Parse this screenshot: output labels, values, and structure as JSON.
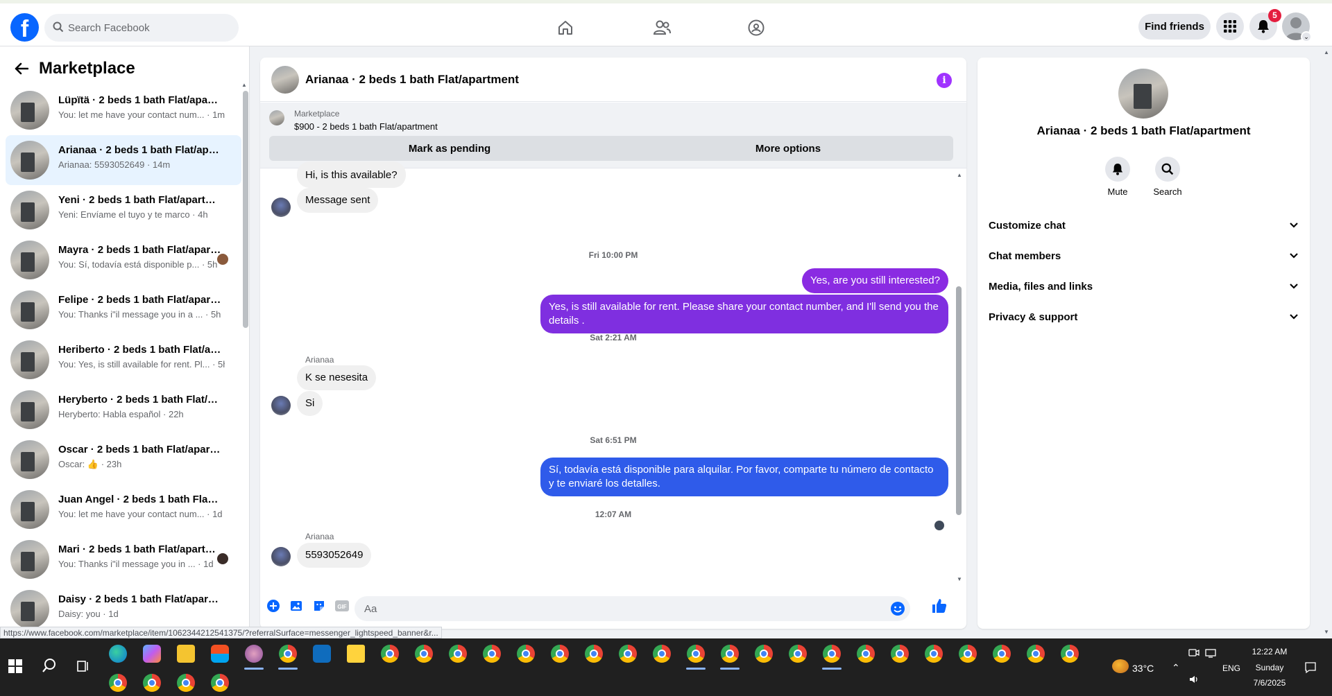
{
  "topbar": {
    "search_placeholder": "Search Facebook",
    "find_friends": "Find friends",
    "notif_count": "5",
    "nav_icons": [
      "home-icon",
      "friends-icon",
      "groups-icon"
    ]
  },
  "sidebar": {
    "title": "Marketplace",
    "conversations": [
      {
        "name": "Lüpïtä · 2 beds 1 bath Flat/apartment",
        "snippet": "You: let me have your contact num... · 1m"
      },
      {
        "name": "Arianaa · 2 beds 1 bath Flat/apartment",
        "snippet": "Arianaa: 5593052649 · 14m"
      },
      {
        "name": "Yeni · 2 beds 1 bath Flat/apartment",
        "snippet": "Yeni: Envíame el tuyo y te marco · 4h"
      },
      {
        "name": "Mayra · 2 beds 1 bath Flat/apartment",
        "snippet": "You: Sí, todavía está disponible p... · 5h"
      },
      {
        "name": "Felipe · 2 beds 1 bath Flat/apartment",
        "snippet": "You: Thanks i\"il message you in a ... · 5h"
      },
      {
        "name": "Heriberto · 2 beds 1 bath Flat/apartment",
        "snippet": "You: Yes, is still available for rent. Pl... · 5h"
      },
      {
        "name": "Heryberto · 2 beds 1 bath Flat/apartment",
        "snippet": "Heryberto: Habla español · 22h"
      },
      {
        "name": "Oscar · 2 beds 1 bath Flat/apartment",
        "snippet": "Oscar: 👍 · 23h"
      },
      {
        "name": "Juan Angel · 2 beds 1 bath Flat/apartment",
        "snippet": "You: let me have your contact num... · 1d"
      },
      {
        "name": "Mari · 2 beds 1 bath Flat/apartment",
        "snippet": "You: Thanks i\"il message you in ... · 1d"
      },
      {
        "name": "Daisy · 2 beds 1 bath Flat/apartment",
        "snippet": "Daisy: you · 1d"
      }
    ]
  },
  "status_url": "https://www.facebook.com/marketplace/item/1062344212541375/?referralSurface=messenger_lightspeed_banner&r...",
  "chat": {
    "title": "Arianaa · 2 beds 1 bath Flat/apartment",
    "listing_source": "Marketplace",
    "listing_name": "$900 - 2 beds 1 bath Flat/apartment",
    "mark_pending": "Mark as pending",
    "more_options": "More options",
    "messages": {
      "m1": "Hi, is this available?",
      "m2": "Message sent",
      "ts1": "Fri 10:00 PM",
      "m3": "Yes, are you still interested?",
      "m4": "Yes, is still available for rent. Please share your contact number, and I'll send you the details .",
      "ts2": "Sat 2:21 AM",
      "sender1": "Arianaa",
      "m5": "K se nesesita",
      "m6": "Si",
      "ts3": "Sat 6:51 PM",
      "m7": "Sí, todavía está disponible para alquilar. Por favor, comparte tu número de contacto y te enviaré los detalles.",
      "ts4": "12:07 AM",
      "sender2": "Arianaa",
      "m8": "5593052649"
    },
    "composer_placeholder": "Aa"
  },
  "rpanel": {
    "name": "Arianaa · 2 beds 1 bath Flat/apartment",
    "mute": "Mute",
    "search": "Search",
    "sections": [
      "Customize chat",
      "Chat members",
      "Media, files and links",
      "Privacy & support"
    ]
  },
  "taskbar": {
    "weather": "33°C",
    "lang": "ENG",
    "time": "12:22 AM",
    "day": "Sunday",
    "date": "7/6/2025"
  },
  "colors": {
    "accent_purple": "#a033ff",
    "bubble_purple": "#8a2be2",
    "bubble_blue": "#2f5bea",
    "fb_blue": "#0866ff"
  }
}
